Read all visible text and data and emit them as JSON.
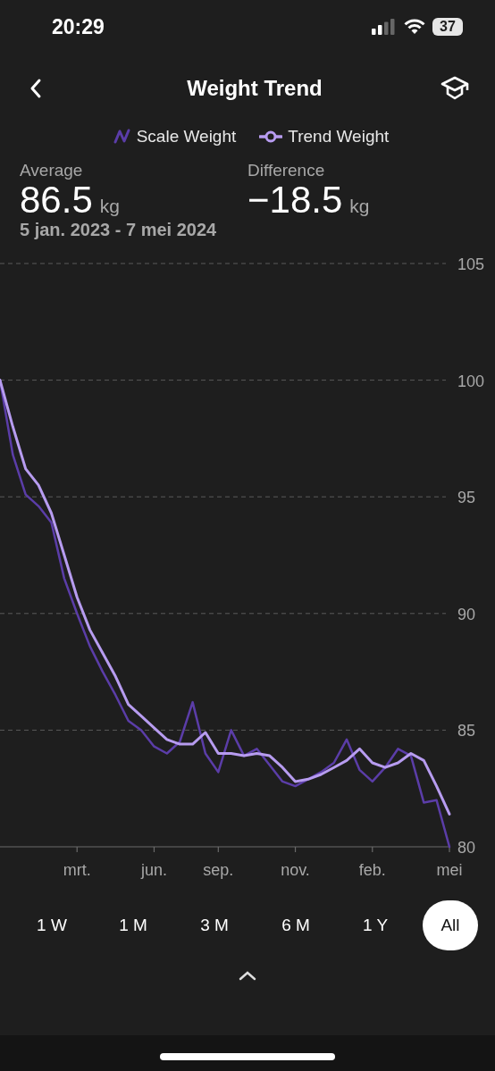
{
  "status_bar": {
    "time": "20:29",
    "battery": "37"
  },
  "header": {
    "title": "Weight Trend"
  },
  "stats": [
    {
      "label": "Average",
      "value": "86.5",
      "unit": "kg"
    },
    {
      "label": "Difference",
      "value": "−18.5",
      "unit": "kg"
    }
  ],
  "date_range": "5 jan. 2023 - 7 mei 2024",
  "legend": [
    {
      "kind": "wave"
    },
    {
      "kind": "dot-line"
    }
  ],
  "chart_data": {
    "type": "line",
    "categories": [
      null,
      null,
      null,
      null,
      null,
      null,
      "mrt.",
      null,
      null,
      null,
      null,
      null,
      "jun.",
      null,
      null,
      null,
      null,
      "sep.",
      null,
      null,
      null,
      null,
      null,
      "nov.",
      null,
      null,
      null,
      null,
      null,
      "feb.",
      null,
      null,
      null,
      null,
      null,
      "mei"
    ],
    "series": [
      {
        "name": "Scale Weight",
        "color": "#5b3da8",
        "values": [
          100,
          96.8,
          95.1,
          94.6,
          93.9,
          91.5,
          90.0,
          88.6,
          87.5,
          86.5,
          85.4,
          85.0,
          84.3,
          84.0,
          84.5,
          86.2,
          84.0,
          83.2,
          85.0,
          83.9,
          84.2,
          83.5,
          82.8,
          82.6,
          82.9,
          83.2,
          83.6,
          84.6,
          83.3,
          82.8,
          83.4,
          84.2,
          83.9,
          81.9,
          82.0,
          80.0
        ]
      },
      {
        "name": "Trend Weight",
        "color": "#b79cf0",
        "values": [
          100,
          98.0,
          96.2,
          95.5,
          94.3,
          92.5,
          90.7,
          89.3,
          88.3,
          87.3,
          86.1,
          85.6,
          85.1,
          84.6,
          84.4,
          84.4,
          84.9,
          84.0,
          84.0,
          83.9,
          84.0,
          83.9,
          83.4,
          82.8,
          82.9,
          83.1,
          83.4,
          83.7,
          84.2,
          83.6,
          83.4,
          83.6,
          84.0,
          83.7,
          82.6,
          81.4
        ]
      }
    ],
    "grid": true,
    "ylim": [
      80,
      105
    ],
    "yticks": [
      80,
      85,
      90,
      95,
      100,
      105
    ]
  },
  "ranges": [
    {
      "label": "1 W",
      "selected": false
    },
    {
      "label": "1 M",
      "selected": false
    },
    {
      "label": "3 M",
      "selected": false
    },
    {
      "label": "6 M",
      "selected": false
    },
    {
      "label": "1 Y",
      "selected": false
    },
    {
      "label": "All",
      "selected": true
    }
  ]
}
